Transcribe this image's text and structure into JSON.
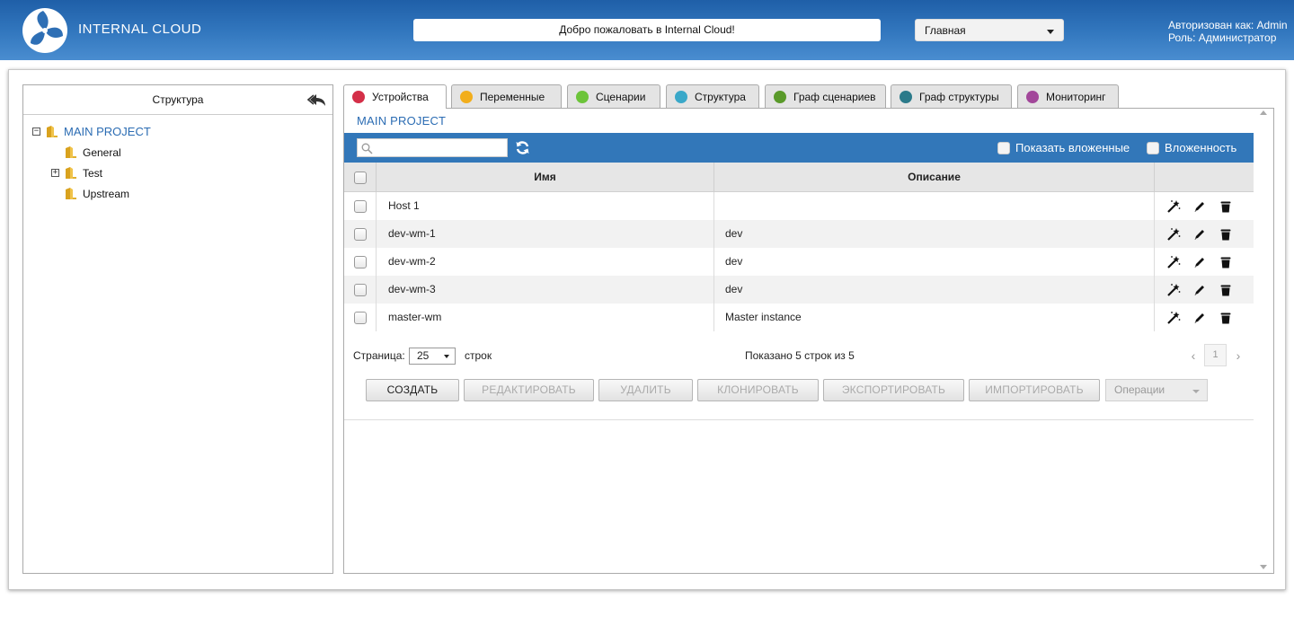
{
  "header": {
    "app_title": "INTERNAL CLOUD",
    "welcome": "Добро пожаловать в Internal Cloud!",
    "nav_selected": "Главная",
    "user_line": "Авторизован как: Admin",
    "role_line": "Роль: Администратор",
    "logo_icon": "internal-cloud-logo"
  },
  "tree": {
    "title": "Структура",
    "root": "MAIN PROJECT",
    "children": [
      "General",
      "Test",
      "Upstream"
    ]
  },
  "tabs": [
    {
      "label": "Устройства",
      "color": "#d42f48"
    },
    {
      "label": "Переменные",
      "color": "#f2ae1c"
    },
    {
      "label": "Сценарии",
      "color": "#6cc43a"
    },
    {
      "label": "Структура",
      "color": "#3aa8c9"
    },
    {
      "label": "Граф сценариев",
      "color": "#5a9a2a"
    },
    {
      "label": "Граф структуры",
      "color": "#2b7a8a"
    },
    {
      "label": "Мониторинг",
      "color": "#a2479a"
    }
  ],
  "breadcrumb": "MAIN PROJECT",
  "toolbar": {
    "search_placeholder": "",
    "show_nested": "Показать вложенные",
    "nesting": "Вложенность"
  },
  "table": {
    "headers": {
      "name": "Имя",
      "description": "Описание"
    },
    "rows": [
      {
        "name": "Host 1",
        "description": ""
      },
      {
        "name": "dev-wm-1",
        "description": "dev"
      },
      {
        "name": "dev-wm-2",
        "description": "dev"
      },
      {
        "name": "dev-wm-3",
        "description": "dev"
      },
      {
        "name": "master-wm",
        "description": "Master instance"
      }
    ]
  },
  "pager": {
    "page_label": "Страница:",
    "page_size": "25",
    "rows_label": "строк",
    "shown_text": "Показано 5 строк из 5",
    "current_page": "1",
    "prev": "‹",
    "next": "›"
  },
  "buttons": {
    "create": "СОЗДАТЬ",
    "edit": "РЕДАКТИРОВАТЬ",
    "delete": "УДАЛИТЬ",
    "clone": "КЛОНИРОВАТЬ",
    "export": "ЭКСПОРТИРОВАТЬ",
    "import": "ИМПОРТИРОВАТЬ",
    "operations": "Операции"
  },
  "colors": {
    "header_blue": "#2e6fb5",
    "toolbar_blue": "#3277b9",
    "link_blue": "#2b6cb3"
  }
}
